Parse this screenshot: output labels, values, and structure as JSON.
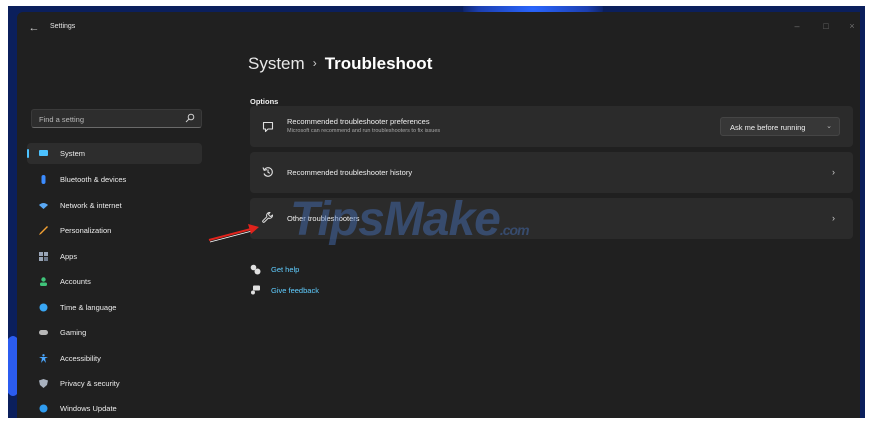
{
  "window": {
    "back_glyph": "←",
    "title": "Settings",
    "controls": {
      "minimize": "–",
      "maximize": "□",
      "close": "×"
    }
  },
  "sidebar": {
    "search_placeholder": "Find a setting",
    "items": [
      {
        "label": "System",
        "icon": "monitor-icon",
        "color": "#4cc2ff",
        "active": true
      },
      {
        "label": "Bluetooth & devices",
        "icon": "bluetooth-icon",
        "color": "#3b8cff"
      },
      {
        "label": "Network & internet",
        "icon": "wifi-icon",
        "color": "#5aa9f5"
      },
      {
        "label": "Personalization",
        "icon": "brush-icon",
        "color": "#f2a033"
      },
      {
        "label": "Apps",
        "icon": "apps-icon",
        "color": "#9aa6b8"
      },
      {
        "label": "Accounts",
        "icon": "person-icon",
        "color": "#3fc47a"
      },
      {
        "label": "Time & language",
        "icon": "globe-clock-icon",
        "color": "#39a7f5"
      },
      {
        "label": "Gaming",
        "icon": "gamepad-icon",
        "color": "#b8b8b8"
      },
      {
        "label": "Accessibility",
        "icon": "accessibility-icon",
        "color": "#4aa7ff"
      },
      {
        "label": "Privacy & security",
        "icon": "shield-icon",
        "color": "#a9b2bf"
      },
      {
        "label": "Windows Update",
        "icon": "update-icon",
        "color": "#2f9cf0"
      }
    ]
  },
  "main": {
    "breadcrumb_parent": "System",
    "breadcrumb_sep": "›",
    "breadcrumb_current": "Troubleshoot",
    "section_title": "Options",
    "cards": {
      "preferences": {
        "title": "Recommended troubleshooter preferences",
        "description": "Microsoft can recommend and run troubleshooters to fix issues",
        "dropdown_value": "Ask me before running",
        "icon": "chat-icon"
      },
      "history": {
        "title": "Recommended troubleshooter history",
        "icon": "history-icon"
      },
      "other": {
        "title": "Other troubleshooters",
        "icon": "wrench-icon"
      }
    },
    "links": [
      {
        "label": "Get help",
        "icon": "help-icon"
      },
      {
        "label": "Give feedback",
        "icon": "feedback-icon"
      }
    ],
    "chevron_glyph": "›",
    "dropdown_glyph": "⌄"
  },
  "watermark": {
    "text": "TipsMake",
    "suffix": ".com"
  },
  "colors": {
    "window_bg": "#202020",
    "card_bg": "#2b2b2b",
    "accent": "#4cc2ff",
    "link": "#60cdff",
    "annotation": "#e0231c"
  }
}
